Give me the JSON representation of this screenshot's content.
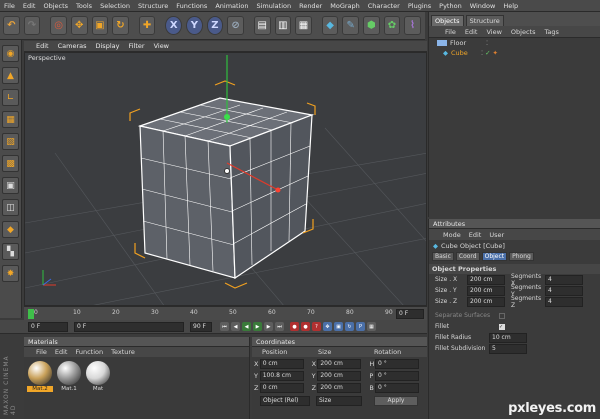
{
  "menubar": [
    "File",
    "Edit",
    "Objects",
    "Tools",
    "Selection",
    "Structure",
    "Functions",
    "Animation",
    "Simulation",
    "Render",
    "MoGraph",
    "Character",
    "Plugins",
    "Python",
    "Window",
    "Help"
  ],
  "toolbar": {
    "icons": [
      "undo-icon",
      "redo-icon",
      "live-select-icon",
      "move-icon",
      "scale-icon",
      "rotate-icon",
      "add-icon",
      "x-axis-icon",
      "y-axis-icon",
      "z-axis-icon",
      "world-coords-icon",
      "render-view-icon",
      "render-picture-icon",
      "render-settings-icon",
      "cube-primitive-icon",
      "pen-icon",
      "subdivision-icon",
      "array-icon",
      "deformer-icon",
      "scene-icon"
    ],
    "x_label": "X",
    "y_label": "Y",
    "z_label": "Z"
  },
  "viewport": {
    "menu": [
      "Edit",
      "Cameras",
      "Display",
      "Filter",
      "View"
    ],
    "label": "Perspective"
  },
  "timeline": {
    "ticks": [
      "0",
      "10",
      "20",
      "30",
      "40",
      "50",
      "60",
      "70",
      "80",
      "90"
    ],
    "end_field": "0 F"
  },
  "playbar": {
    "start": "0 F",
    "current": "0 F",
    "end": "90 F"
  },
  "materials": {
    "title": "Materials",
    "menu": [
      "File",
      "Edit",
      "Function",
      "Texture"
    ],
    "items": [
      {
        "label": "Mat.2",
        "color": "#c9a15a"
      },
      {
        "label": "Mat.1",
        "color": "#9a9a9a"
      },
      {
        "label": "Mat",
        "color": "#d8d8d8"
      }
    ]
  },
  "coordinates": {
    "title": "Coordinates",
    "columns": [
      "Position",
      "Size",
      "Rotation"
    ],
    "rows": [
      {
        "axis": "X",
        "pos": "0 cm",
        "saxis": "X",
        "size": "200 cm",
        "raxis": "H",
        "rot": "0 °"
      },
      {
        "axis": "Y",
        "pos": "100.8 cm",
        "saxis": "Y",
        "size": "200 cm",
        "raxis": "P",
        "rot": "0 °"
      },
      {
        "axis": "Z",
        "pos": "0 cm",
        "saxis": "Z",
        "size": "200 cm",
        "raxis": "B",
        "rot": "0 °"
      }
    ],
    "mode": "Object (Rel)",
    "size_mode": "Size",
    "apply": "Apply"
  },
  "objects": {
    "tabs": [
      "Objects",
      "Structure"
    ],
    "menu": [
      "File",
      "Edit",
      "View",
      "Objects",
      "Tags"
    ],
    "items": [
      {
        "name": "Floor"
      },
      {
        "name": "Cube"
      }
    ]
  },
  "attributes": {
    "title": "Attributes",
    "menu": [
      "Mode",
      "Edit",
      "User"
    ],
    "object_title": "Cube Object [Cube]",
    "tabs": [
      "Basic",
      "Coord",
      "Object",
      "Phong"
    ],
    "active_tab": "Object",
    "section": "Object Properties",
    "rows": [
      {
        "label": "Size . X",
        "value": "200 cm",
        "label2": "Segments X",
        "value2": "4"
      },
      {
        "label": "Size . Y",
        "value": "200 cm",
        "label2": "Segments Y",
        "value2": "4"
      },
      {
        "label": "Size . Z",
        "value": "200 cm",
        "label2": "Segments Z",
        "value2": "4"
      }
    ],
    "separate": "Separate Surfaces",
    "fillet": "Fillet",
    "fillet_radius_label": "Fillet Radius",
    "fillet_radius": "10 cm",
    "fillet_sub_label": "Fillet Subdivision",
    "fillet_sub": "5"
  },
  "brand": {
    "vertical": "MAXON CINEMA 4D",
    "watermark": "pxleyes.com"
  }
}
